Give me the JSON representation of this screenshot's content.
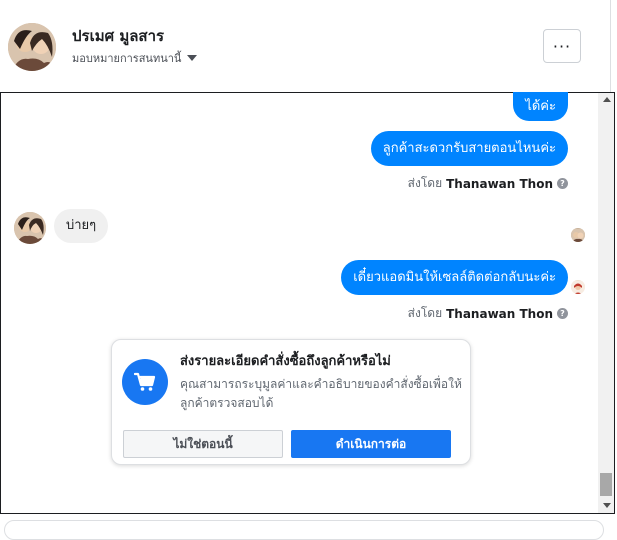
{
  "header": {
    "contact_name": "ปรเมศ มูลสาร",
    "assign_label": "มอบหมายการสนทนานี้",
    "more_label": "···"
  },
  "messages": {
    "out_1": "ได้ค่ะ",
    "out_2": "ลูกค้าสะดวกรับสายตอนไหนค่ะ",
    "sent_by_prefix_1": "ส่งโดย",
    "sent_by_name_1": "Thanawan Thon",
    "in_1": "บ่ายๆ",
    "out_3": "เดี๋ยวแอดมินให้เซลล์ติดต่อกลับนะค่ะ",
    "sent_by_prefix_2": "ส่งโดย",
    "sent_by_name_2": "Thanawan Thon",
    "help_glyph": "?"
  },
  "order_prompt": {
    "title": "ส่งรายละเอียดคำสั่งซื้อถึงลูกค้าหรือไม่",
    "description": "คุณสามารถระบุมูลค่าและคำอธิบายของคำสั่งซื้อเพื่อให้ลูกค้าตรวจสอบได้",
    "decline_label": "ไม่ใช่ตอนนี้",
    "continue_label": "ดำเนินการต่อ",
    "icon": "shopping-cart-icon"
  },
  "colors": {
    "outgoing_bubble": "#0084ff",
    "incoming_bubble": "#f0f0f0",
    "primary_button": "#1877f2"
  }
}
